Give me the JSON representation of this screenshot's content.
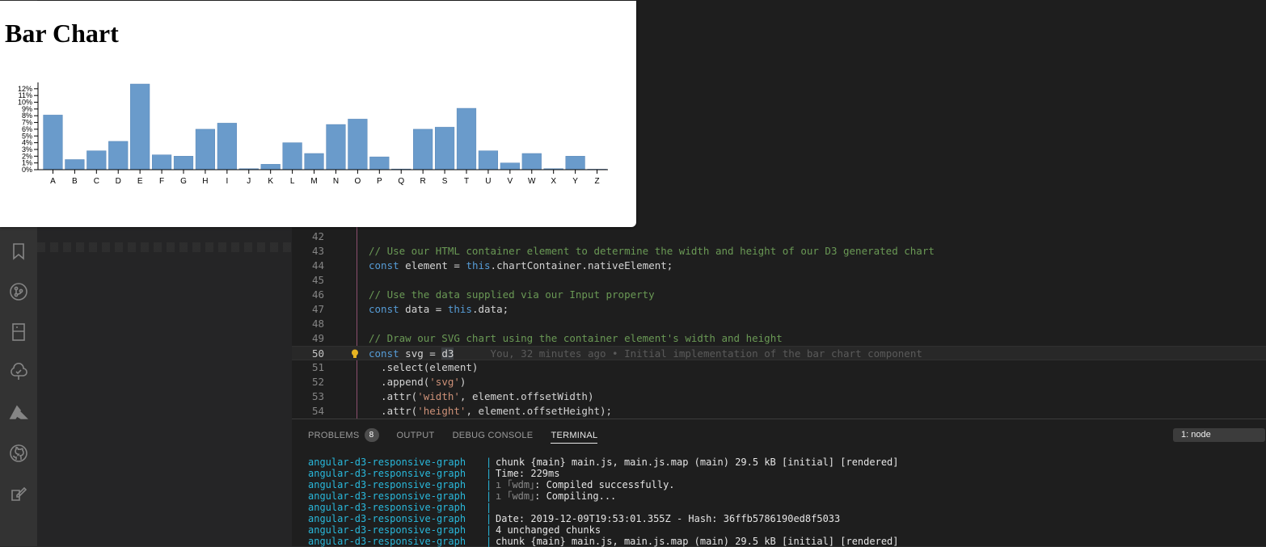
{
  "activity_bar": {
    "icons": [
      "bookmark-icon",
      "source-control-icon",
      "remote-explorer-icon",
      "tree-check-icon",
      "azure-icon",
      "github-icon",
      "edit-pen-icon"
    ]
  },
  "editor": {
    "lines": [
      {
        "num": "42",
        "segments": []
      },
      {
        "num": "43",
        "segments": [
          {
            "cls": "c-comment",
            "text": "// Use our HTML container element to determine the width and height of our D3 generated chart"
          }
        ]
      },
      {
        "num": "44",
        "segments": [
          {
            "cls": "c-kw",
            "text": "const"
          },
          {
            "cls": "c-plain",
            "text": " element = "
          },
          {
            "cls": "c-kw",
            "text": "this"
          },
          {
            "cls": "c-plain",
            "text": ".chartContainer.nativeElement;"
          }
        ]
      },
      {
        "num": "45",
        "segments": []
      },
      {
        "num": "46",
        "segments": [
          {
            "cls": "c-comment",
            "text": "// Use the data supplied via our Input property"
          }
        ]
      },
      {
        "num": "47",
        "segments": [
          {
            "cls": "c-kw",
            "text": "const"
          },
          {
            "cls": "c-plain",
            "text": " data = "
          },
          {
            "cls": "c-kw",
            "text": "this"
          },
          {
            "cls": "c-plain",
            "text": ".data;"
          }
        ]
      },
      {
        "num": "48",
        "segments": []
      },
      {
        "num": "49",
        "segments": [
          {
            "cls": "c-comment",
            "text": "// Draw our SVG chart using the container element's width and height"
          }
        ]
      },
      {
        "num": "50",
        "current": true,
        "segments": [
          {
            "cls": "c-kw",
            "text": "const"
          },
          {
            "cls": "c-plain",
            "text": " svg = "
          },
          {
            "cls": "c-plain c-sel",
            "text": "d3"
          },
          {
            "cls": "c-blame",
            "text": "      You, 32 minutes ago • Initial implementation of the bar chart component"
          }
        ]
      },
      {
        "num": "51",
        "segments": [
          {
            "cls": "c-plain",
            "text": "  .select(element)"
          }
        ]
      },
      {
        "num": "52",
        "segments": [
          {
            "cls": "c-plain",
            "text": "  .append("
          },
          {
            "cls": "c-str",
            "text": "'svg'"
          },
          {
            "cls": "c-plain",
            "text": ")"
          }
        ]
      },
      {
        "num": "53",
        "segments": [
          {
            "cls": "c-plain",
            "text": "  .attr("
          },
          {
            "cls": "c-str",
            "text": "'width'"
          },
          {
            "cls": "c-plain",
            "text": ", element.offsetWidth)"
          }
        ]
      },
      {
        "num": "54",
        "segments": [
          {
            "cls": "c-plain",
            "text": "  .attr("
          },
          {
            "cls": "c-str",
            "text": "'height'"
          },
          {
            "cls": "c-plain",
            "text": ", element.offsetHeight);"
          }
        ]
      }
    ]
  },
  "panel": {
    "tabs": {
      "problems": "PROBLEMS",
      "problems_count": "8",
      "output": "OUTPUT",
      "debug_console": "DEBUG CONSOLE",
      "terminal": "TERMINAL"
    },
    "terminal_select": "1: node",
    "terminal_lines": [
      {
        "prefix": "angular-d3-responsive-graph",
        "sep": "|",
        "msg": "chunk {main} main.js, main.js.map (main) 29.5 kB [initial] [rendered]"
      },
      {
        "prefix": "angular-d3-responsive-graph",
        "sep": "|",
        "msg": "Time: 229ms"
      },
      {
        "prefix": "angular-d3-responsive-graph",
        "sep": "|",
        "wdm": "ı ｢wdm｣",
        "msg": ": Compiled successfully."
      },
      {
        "prefix": "angular-d3-responsive-graph",
        "sep": "|",
        "wdm": "ı ｢wdm｣",
        "msg": ": Compiling..."
      },
      {
        "prefix": "angular-d3-responsive-graph",
        "sep": "|",
        "msg": ""
      },
      {
        "prefix": "angular-d3-responsive-graph",
        "sep": "|",
        "msg": "Date: 2019-12-09T19:53:01.355Z - Hash: 36ffb5786190ed8f5033"
      },
      {
        "prefix": "angular-d3-responsive-graph",
        "sep": "|",
        "msg": "4 unchanged chunks"
      },
      {
        "prefix": "angular-d3-responsive-graph",
        "sep": "|",
        "msg": "chunk {main} main.js, main.js.map (main) 29.5 kB [initial] [rendered]"
      }
    ]
  },
  "browser": {
    "title": "Bar Chart"
  },
  "chart_data": {
    "type": "bar",
    "title": "Bar Chart",
    "xlabel": "",
    "ylabel": "",
    "ylim": [
      0,
      12.7
    ],
    "y_ticks": [
      "0%",
      "1%",
      "2%",
      "3%",
      "4%",
      "5%",
      "6%",
      "7%",
      "8%",
      "9%",
      "10%",
      "11%",
      "12%"
    ],
    "bar_color": "#6a9bcb",
    "categories": [
      "A",
      "B",
      "C",
      "D",
      "E",
      "F",
      "G",
      "H",
      "I",
      "J",
      "K",
      "L",
      "M",
      "N",
      "O",
      "P",
      "Q",
      "R",
      "S",
      "T",
      "U",
      "V",
      "W",
      "X",
      "Y",
      "Z"
    ],
    "values": [
      8.1,
      1.5,
      2.8,
      4.2,
      12.7,
      2.2,
      2.0,
      6.0,
      6.9,
      0.15,
      0.8,
      4.0,
      2.4,
      6.7,
      7.5,
      1.9,
      0.1,
      6.0,
      6.3,
      9.1,
      2.8,
      1.0,
      2.4,
      0.15,
      2.0,
      0.07
    ]
  }
}
